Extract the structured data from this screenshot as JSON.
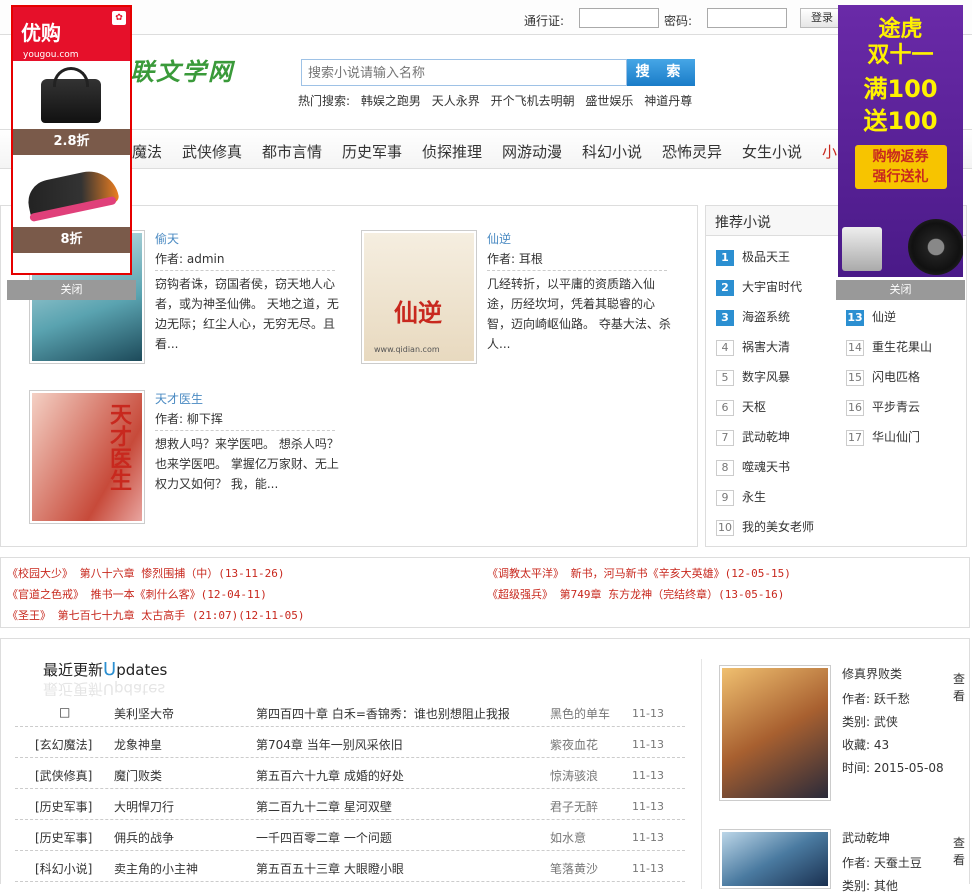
{
  "topbar": {
    "passport_label": "通行证:",
    "password_label": "密码:",
    "login_label": "登录"
  },
  "logo": {
    "text": "联文学网"
  },
  "search": {
    "placeholder": "搜索小说请输入名称",
    "button": "搜 索",
    "hot_label": "热门搜索:",
    "hot": [
      "韩娱之跑男",
      "天人永界",
      "开个飞机去明朝",
      "盛世娱乐",
      "神道丹尊"
    ]
  },
  "nav": [
    "魔法",
    "武侠修真",
    "都市言情",
    "历史军事",
    "侦探推理",
    "网游动漫",
    "科幻小说",
    "恐怖灵异",
    "女生小说",
    "小"
  ],
  "featured": [
    {
      "title": "偷天",
      "author": "作者: admin",
      "desc": "窃钩者诛，窃国者侯，窃天地人心者，或为神圣仙佛。 天地之道，无边无际；红尘人心，无穷无尽。且看..."
    },
    {
      "title": "仙逆",
      "author": "作者: 耳根",
      "desc": "几经转折，以平庸的资质踏入仙途，历经坎坷，凭着其聪睿的心智，迈向崎岖仙路。 夺基大法、杀人..."
    },
    {
      "title": "天才医生",
      "author": "作者: 柳下挥",
      "desc": "想救人吗？来学医吧。 想杀人吗？也来学医吧。 掌握亿万家财、无上权力又如何？ 我，能..."
    }
  ],
  "cover_text": {
    "xianni_title": "仙逆",
    "xianni_url": "www.qidian.com",
    "tiancai_title": "天才医生"
  },
  "rank": {
    "title": "推荐小说",
    "left": [
      {
        "n": "1",
        "t": "极品天王"
      },
      {
        "n": "2",
        "t": "大宇宙时代"
      },
      {
        "n": "3",
        "t": "海盗系统"
      },
      {
        "n": "4",
        "t": "祸害大清"
      },
      {
        "n": "5",
        "t": "数字风暴"
      },
      {
        "n": "6",
        "t": "天枢"
      },
      {
        "n": "7",
        "t": "武动乾坤"
      },
      {
        "n": "8",
        "t": "噬魂天书"
      },
      {
        "n": "9",
        "t": "永生"
      },
      {
        "n": "10",
        "t": "我的美女老师"
      }
    ],
    "right": [
      {
        "n": "13",
        "t": "仙逆"
      },
      {
        "n": "14",
        "t": "重生花果山"
      },
      {
        "n": "15",
        "t": "闪电匹格"
      },
      {
        "n": "16",
        "t": "平步青云"
      },
      {
        "n": "17",
        "t": "华山仙门"
      }
    ]
  },
  "news": [
    "《校园大少》 第八十六章 惨烈围捕（中）(13-11-26)",
    "《调教太平洋》 新书，河马新书《辛亥大英雄》(12-05-15)",
    "《官道之色戒》 推书一本《刺什么客》(12-04-11)",
    "《超级强兵》 第749章 东方龙神（完结终章）(13-05-16)",
    "《圣王》 第七百七十九章 太古高手 (21:07)(12-11-05)"
  ],
  "updates": {
    "heading_pre": "最近更新",
    "heading_u": "U",
    "heading_post": "pdates",
    "rows": [
      {
        "cat": "□",
        "name": "美利坚大帝",
        "chap": "第四百四十章 白禾=香锦秀：谁也别想阻止我报",
        "author": "黑色的单车",
        "date": "11-13"
      },
      {
        "cat": "[玄幻魔法]",
        "name": "龙象神皇",
        "chap": "第704章 当年一别风采依旧",
        "author": "紫夜血花",
        "date": "11-13"
      },
      {
        "cat": "[武侠修真]",
        "name": "魔门败类",
        "chap": "第五百六十九章 成婚的好处",
        "author": "惊涛骇浪",
        "date": "11-13"
      },
      {
        "cat": "[历史军事]",
        "name": "大明悍刀行",
        "chap": "第二百九十二章 星河双壁",
        "author": "君子无醉",
        "date": "11-13"
      },
      {
        "cat": "[历史军事]",
        "name": "佣兵的战争",
        "chap": "一千四百零二章 一个问题",
        "author": "如水意",
        "date": "11-13"
      },
      {
        "cat": "[科幻小说]",
        "name": "卖主角的小主神",
        "chap": "第五百五十三章 大眼瞪小眼",
        "author": "笔落黄沙",
        "date": "11-13"
      }
    ],
    "side": [
      {
        "title": "修真界败类",
        "author": "作者: 跃千愁",
        "category": "类别: 武侠",
        "collect": "收藏: 43",
        "time": "时间: 2015-05-08",
        "more": "查看"
      },
      {
        "title": "武动乾坤",
        "author": "作者: 天蚕土豆",
        "category": "类别: 其他",
        "more": "查看"
      }
    ]
  },
  "ads": {
    "left": {
      "brand": "优购",
      "brand_sub": "yougou.com",
      "price1": "2.8折",
      "price2": "8折",
      "close": "关闭"
    },
    "right": {
      "line1": "途虎",
      "line2": "双十一",
      "line3": "满100",
      "line4": "送100",
      "cta1": "购物返券",
      "cta2": "强行送礼",
      "close": "关闭"
    }
  }
}
